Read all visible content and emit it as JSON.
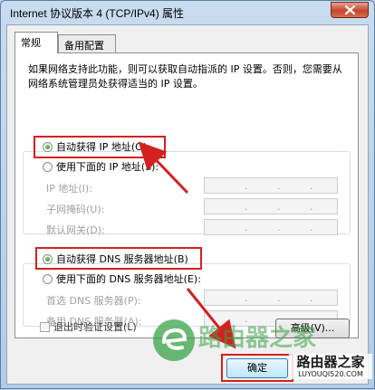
{
  "window": {
    "title": "Internet 协议版本 4 (TCP/IPv4) 属性"
  },
  "tabs": [
    {
      "label": "常规",
      "active": true
    },
    {
      "label": "备用配置",
      "active": false
    }
  ],
  "general": {
    "description": "如果网络支持此功能，则可以获取自动指派的 IP 设置。否则，您需要从网络系统管理员处获得适当的 IP 设置。",
    "auto_ip_label": "自动获得 IP 地址(O)",
    "manual_ip_label": "使用下面的 IP 地址(S):",
    "ip_address_label": "IP 地址(I):",
    "subnet_mask_label": "子网掩码(U):",
    "gateway_label": "默认网关(D):",
    "auto_dns_label": "自动获得 DNS 服务器地址(B)",
    "manual_dns_label": "使用下面的 DNS 服务器地址(E):",
    "preferred_dns_label": "首选 DNS 服务器(P):",
    "alternate_dns_label": "备用 DNS 服务器(A):",
    "validate_label": "退出时验证设置(L)",
    "advanced_label": "高级(V)...",
    "selected_ip_mode": "auto",
    "selected_dns_mode": "auto",
    "validate_checked": false
  },
  "footer": {
    "ok_label": "确定"
  },
  "watermark": {
    "brand_text": "路由器之家",
    "brand_url": "LUYOUQI520.COM",
    "overlay_text": "路由器之家"
  },
  "colors": {
    "highlight": "#d42020",
    "arrow": "#d42020",
    "accent_green": "#2f9e44"
  }
}
